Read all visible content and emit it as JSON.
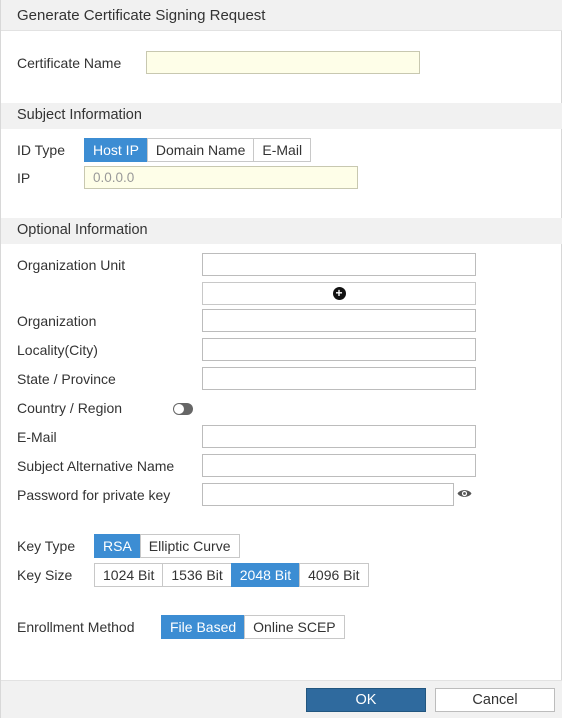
{
  "dialog": {
    "title": "Generate Certificate Signing Request"
  },
  "certificate": {
    "name_label": "Certificate Name",
    "name_value": ""
  },
  "subject": {
    "heading": "Subject Information",
    "id_type_label": "ID Type",
    "id_type_options": [
      "Host IP",
      "Domain Name",
      "E-Mail"
    ],
    "id_type_selected": "Host IP",
    "ip_label": "IP",
    "ip_placeholder": "0.0.0.0"
  },
  "optional": {
    "heading": "Optional Information",
    "org_unit_label": "Organization Unit",
    "organization_label": "Organization",
    "locality_label": "Locality(City)",
    "state_label": "State / Province",
    "country_label": "Country / Region",
    "country_toggle_on": false,
    "email_label": "E-Mail",
    "san_label": "Subject Alternative Name",
    "password_label": "Password for private key"
  },
  "key": {
    "type_label": "Key Type",
    "type_options": [
      "RSA",
      "Elliptic Curve"
    ],
    "type_selected": "RSA",
    "size_label": "Key Size",
    "size_options": [
      "1024 Bit",
      "1536 Bit",
      "2048 Bit",
      "4096 Bit"
    ],
    "size_selected": "2048 Bit"
  },
  "enrollment": {
    "label": "Enrollment Method",
    "options": [
      "File Based",
      "Online SCEP"
    ],
    "selected": "File Based"
  },
  "buttons": {
    "ok": "OK",
    "cancel": "Cancel"
  },
  "icons": {
    "add": "plus-circle-icon",
    "reveal": "eye-icon"
  },
  "colors": {
    "accent": "#3c8dd3",
    "ok_button": "#2f6a9e",
    "header_bg": "#f1f1f1"
  }
}
